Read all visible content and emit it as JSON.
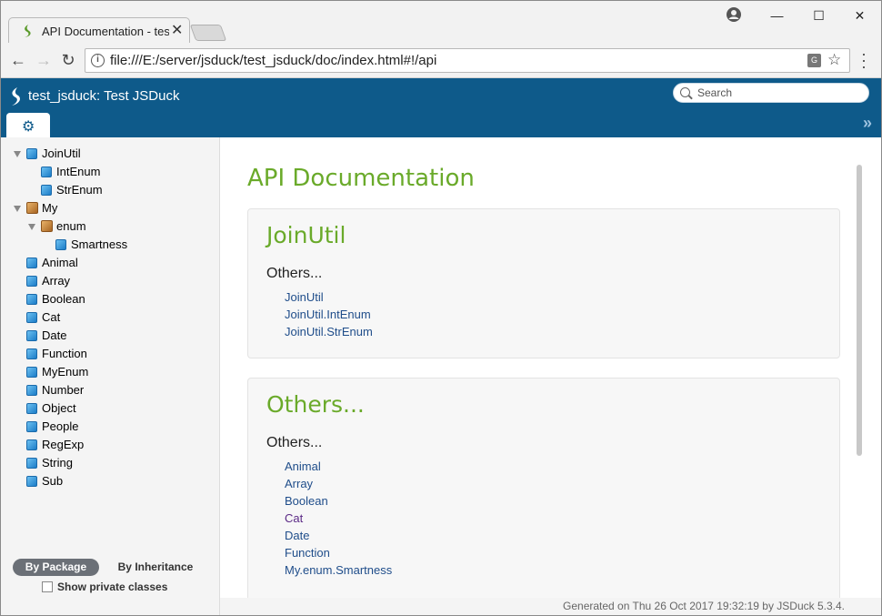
{
  "browser": {
    "tab_title": "API Documentation - test_jsduck",
    "url": "file:///E:/server/jsduck/test_jsduck/doc/index.html#!/api",
    "back_icon": "←",
    "forward_icon": "→",
    "reload_icon": "↻",
    "minimize_icon": "—",
    "maximize_icon": "☐",
    "close_icon": "✕",
    "tab_close_icon": "✕",
    "star_icon": "☆"
  },
  "header": {
    "title": "test_jsduck: Test JSDuck",
    "search_placeholder": "Search",
    "gear_glyph": "⚙",
    "expand_glyph": "»"
  },
  "sidebar": {
    "tree": [
      {
        "label": "JoinUtil",
        "type": "class",
        "expanded": true
      },
      {
        "label": "IntEnum",
        "type": "class"
      },
      {
        "label": "StrEnum",
        "type": "class"
      },
      {
        "label": "My",
        "type": "package",
        "expanded": true
      },
      {
        "label": "enum",
        "type": "package",
        "expanded": true
      },
      {
        "label": "Smartness",
        "type": "class"
      },
      {
        "label": "Animal",
        "type": "class"
      },
      {
        "label": "Array",
        "type": "class"
      },
      {
        "label": "Boolean",
        "type": "class"
      },
      {
        "label": "Cat",
        "type": "class"
      },
      {
        "label": "Date",
        "type": "class"
      },
      {
        "label": "Function",
        "type": "class"
      },
      {
        "label": "MyEnum",
        "type": "class"
      },
      {
        "label": "Number",
        "type": "class"
      },
      {
        "label": "Object",
        "type": "class"
      },
      {
        "label": "People",
        "type": "class"
      },
      {
        "label": "RegExp",
        "type": "class"
      },
      {
        "label": "String",
        "type": "class"
      },
      {
        "label": "Sub",
        "type": "class"
      }
    ],
    "by_package": "By Package",
    "by_inheritance": "By Inheritance",
    "show_private": "Show private classes"
  },
  "content": {
    "title": "API Documentation",
    "cards": [
      {
        "title": "JoinUtil",
        "subtitle": "Others...",
        "links": [
          "JoinUtil",
          "JoinUtil.IntEnum",
          "JoinUtil.StrEnum"
        ]
      },
      {
        "title": "Others...",
        "subtitle": "Others...",
        "links": [
          "Animal",
          "Array",
          "Boolean",
          "Cat",
          "Date",
          "Function",
          "My.enum.Smartness"
        ]
      }
    ]
  },
  "footer": {
    "text": "Generated on Thu 26 Oct 2017 19:32:19 by JSDuck 5.3.4."
  },
  "colors": {
    "header_bg": "#0e5a8a",
    "accent_green": "#6aaa2a",
    "link": "#1f4d8a"
  }
}
